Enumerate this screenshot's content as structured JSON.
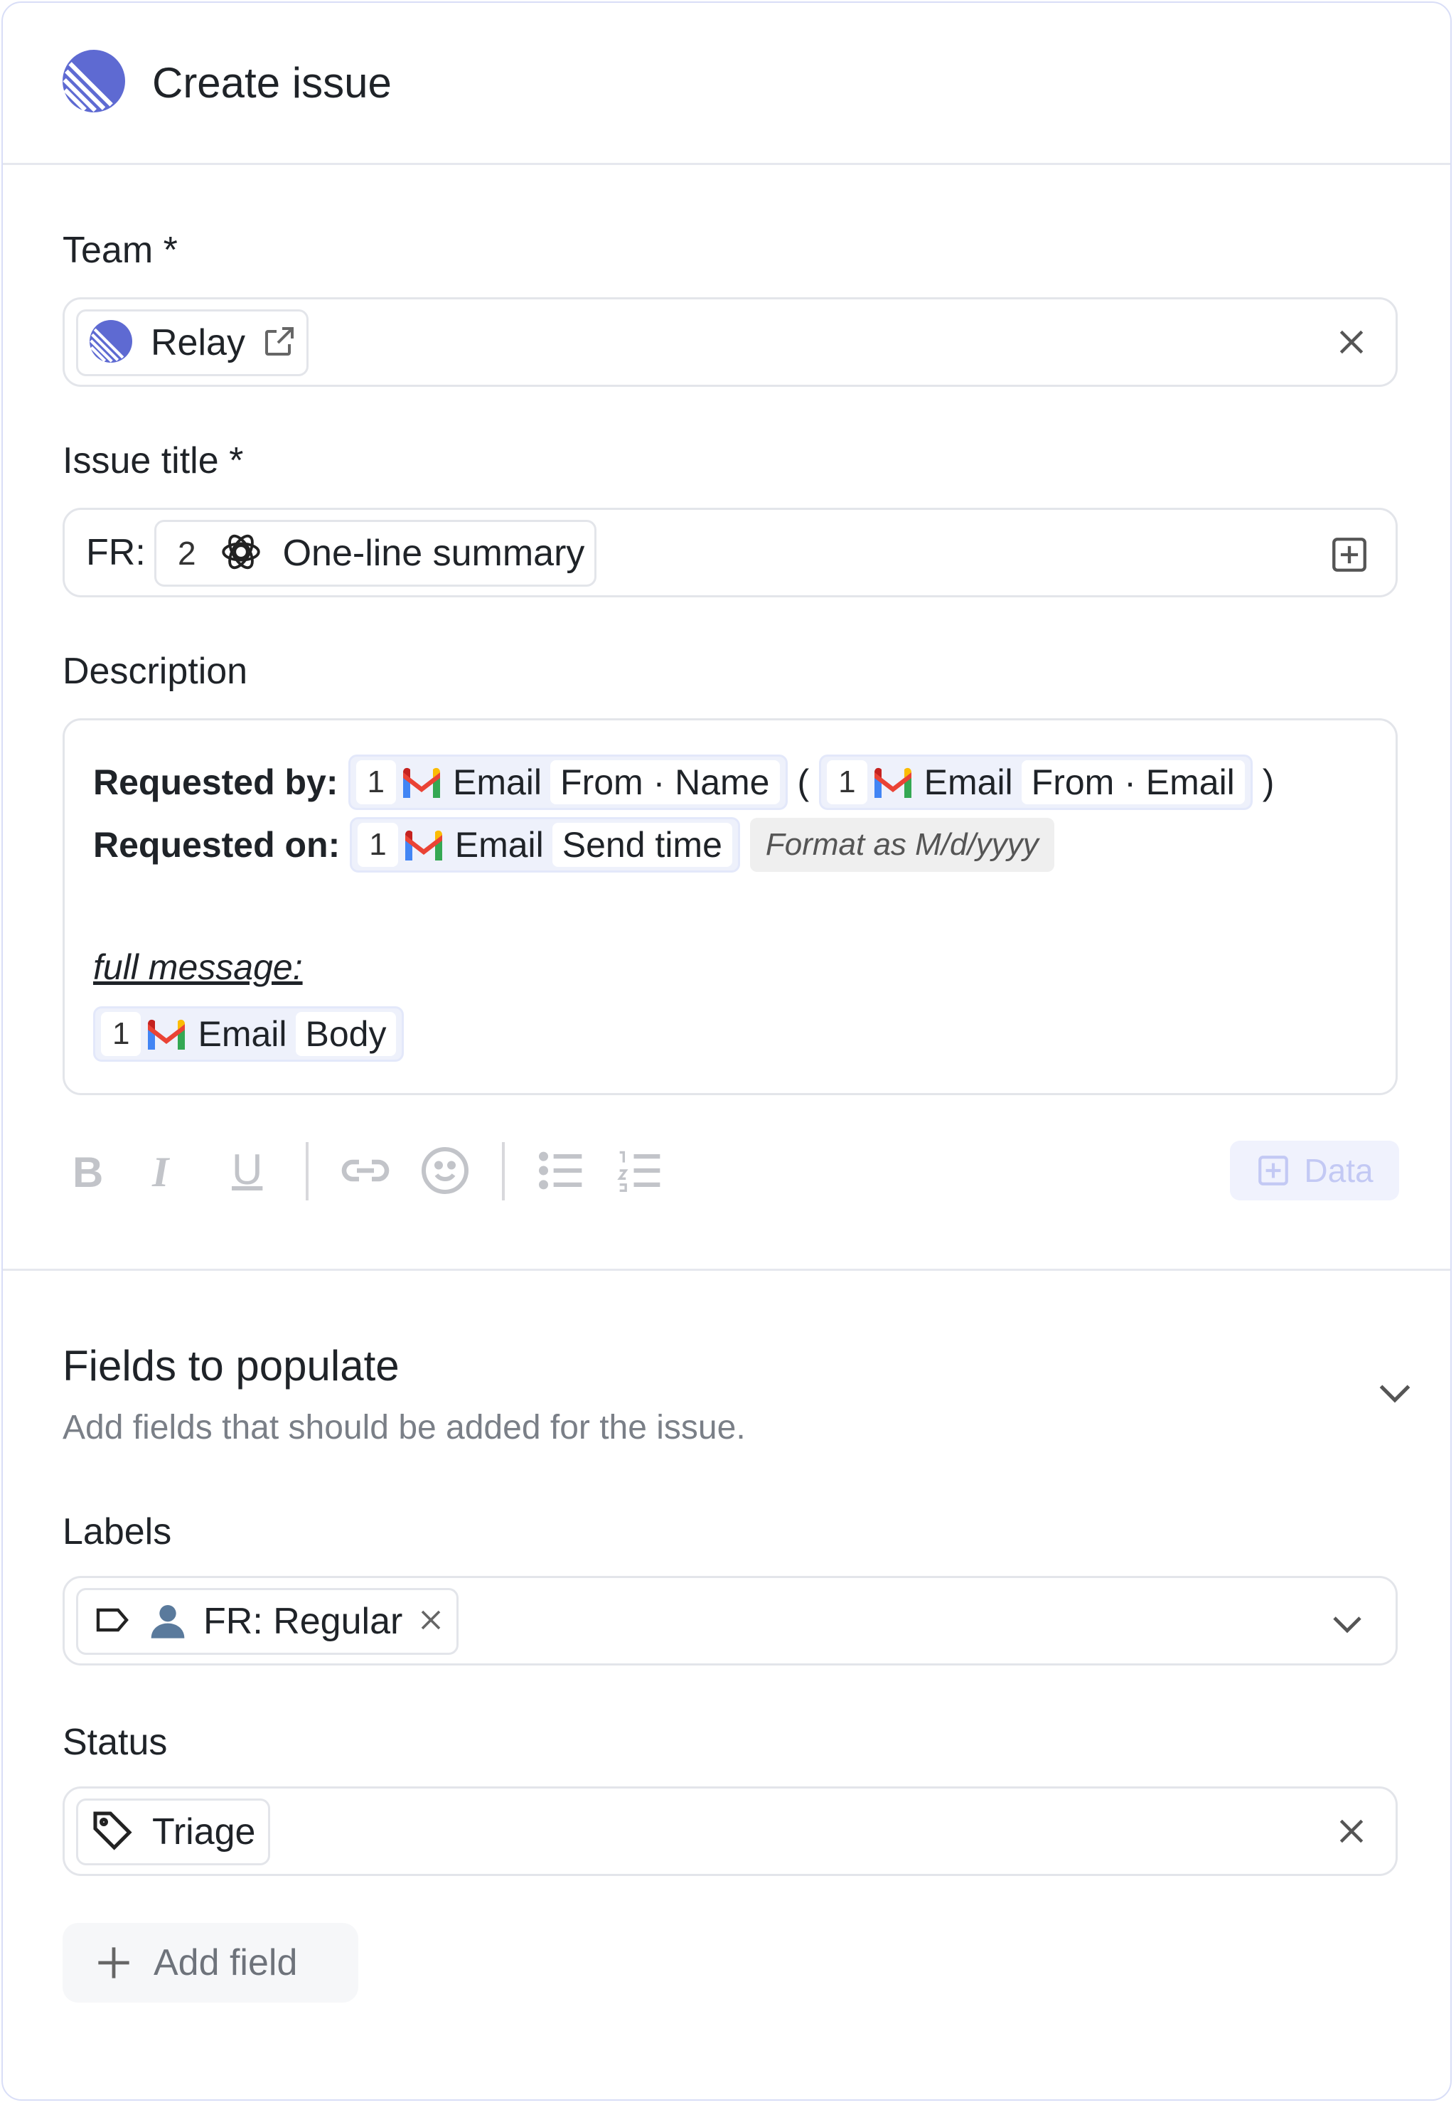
{
  "header": {
    "title": "Create issue",
    "icon": "linear-logo-icon"
  },
  "team": {
    "label": "Team *",
    "value": "Relay"
  },
  "issue_title": {
    "label": "Issue title *",
    "prefix": "FR:",
    "step": "2",
    "token": "One-line summary"
  },
  "description": {
    "label": "Description",
    "requested_by_label": "Requested by:",
    "requested_on_label": "Requested on:",
    "step": "1",
    "source": "Email",
    "from_name": "From · Name",
    "from_email": "From · Email",
    "open_paren": "(",
    "close_paren": ")",
    "send_time": "Send time",
    "format": "Format as M/d/yyyy",
    "full_message_label": "full message:",
    "body": "Body"
  },
  "toolbar": {
    "data_button": "Data"
  },
  "fields_section": {
    "title": "Fields to populate",
    "subtitle": "Add fields that should be added for the issue."
  },
  "labels": {
    "label": "Labels",
    "value": "FR: Regular"
  },
  "status": {
    "label": "Status",
    "value": "Triage"
  },
  "add_field": {
    "label": "Add field"
  },
  "colors": {
    "accent": "#5e6ad2",
    "border": "#e3e5ea",
    "pill_bg": "#eef1fb"
  }
}
